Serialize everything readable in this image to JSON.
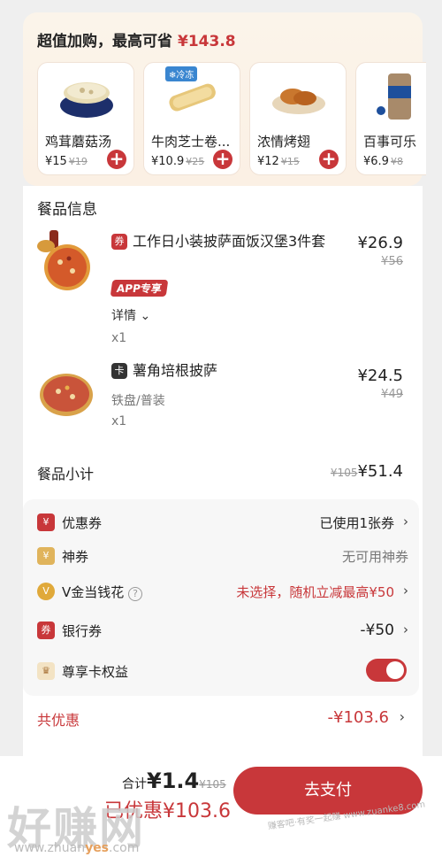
{
  "upsell": {
    "title": "超值加购，最高可省",
    "save_amount": "¥143.8",
    "items": [
      {
        "name": "鸡茸蘑菇汤",
        "price": "¥15",
        "orig": "¥19"
      },
      {
        "name": "牛肉芝士卷...",
        "price": "¥10.9",
        "orig": "¥25",
        "tag": "冷冻"
      },
      {
        "name": "浓情烤翅",
        "price": "¥12",
        "orig": "¥15"
      },
      {
        "name": "百事可乐",
        "price": "¥6.9",
        "orig": "¥8"
      }
    ]
  },
  "order": {
    "section_title": "餐品信息",
    "items": [
      {
        "badge": "券",
        "name": "工作日小装披萨面饭汉堡3件套",
        "app_tag": "APP专享",
        "detail": "详情",
        "qty": "x1",
        "price": "¥26.9",
        "orig": "¥56"
      },
      {
        "badge": "卡",
        "name": "薯角培根披萨",
        "spec": "铁盘/普装",
        "qty": "x1",
        "price": "¥24.5",
        "orig": "¥49"
      }
    ],
    "subtotal_label": "餐品小计",
    "subtotal_orig": "¥105",
    "subtotal": "¥51.4"
  },
  "discounts": [
    {
      "icon": "¥",
      "label": "优惠券",
      "value": "已使用1张券",
      "color": "#c8373a"
    },
    {
      "icon": "¥",
      "label": "神券",
      "value": "无可用神券",
      "color": "#e0b45c"
    },
    {
      "icon": "V",
      "label": "V金当钱花",
      "value": "未选择，随机立减最高¥50",
      "color": "#e0a93a"
    },
    {
      "icon": "券",
      "label": "银行券",
      "value": "-¥50",
      "color": "#c8373a"
    },
    {
      "icon": "♛",
      "label": "尊享卡权益",
      "value": "",
      "color": "#c89a5c"
    }
  ],
  "total_discount": {
    "label": "共优惠",
    "value": "-¥103.6"
  },
  "footer": {
    "sum_label": "合计",
    "sum": "¥1.4",
    "sum_orig": "¥105",
    "saved": "已优惠¥103.6",
    "pay_button": "去支付"
  },
  "watermark": {
    "text": "好赚网",
    "url_prefix": "www.zhuan",
    "url_mid": "yes",
    "url_suffix": ".com",
    "small": "赚客吧·有奖一起赚 www.zuanke8.com"
  },
  "colors": {
    "accent": "#c8373a",
    "bg": "#efefef"
  }
}
